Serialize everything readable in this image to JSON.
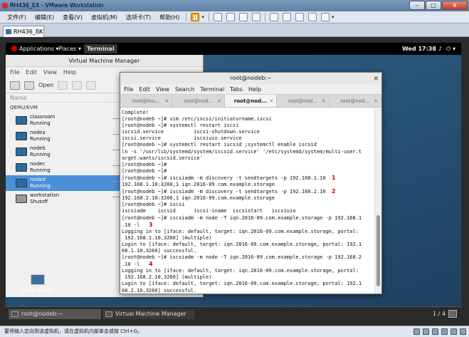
{
  "vmware": {
    "title": "RH436_EX - VMware Workstation",
    "menu": [
      "文件(F)",
      "编辑(E)",
      "查看(V)",
      "虚拟机(M)",
      "选项卡(T)",
      "帮助(H)"
    ],
    "tab_label": "RH436_EX",
    "tab_close": "×",
    "window_buttons": {
      "minimize": "–",
      "maximize": "□",
      "close": "×"
    },
    "status_text": "要将输入定向到该虚拟机，请在虚拟机内部单击或按 Ctrl+G。"
  },
  "gnome": {
    "applications": "Applications ▾",
    "places": "Places ▾",
    "terminal": "Terminal",
    "clock": "Wed 17:38",
    "sys_icons": [
      "♪",
      "⏻ ▾"
    ],
    "desktop_icon_label": "View nodec",
    "taskbar": [
      {
        "label": "root@nodeb:~"
      },
      {
        "label": "Virtual Machine Manager"
      }
    ],
    "pager": "1 / 4"
  },
  "vmm": {
    "title": "Virtual Machine Manager",
    "menu": [
      "File",
      "Edit",
      "View",
      "Help"
    ],
    "toolbar": {
      "open": "Open"
    },
    "header_name": "Name",
    "connection": "QEMU/KVM",
    "vms": [
      {
        "name": "classroom",
        "status": "Running",
        "selected": false,
        "off": false
      },
      {
        "name": "nodea",
        "status": "Running",
        "selected": false,
        "off": false
      },
      {
        "name": "nodeb",
        "status": "Running",
        "selected": false,
        "off": false
      },
      {
        "name": "nodec",
        "status": "Running",
        "selected": false,
        "off": false
      },
      {
        "name": "noded",
        "status": "Running",
        "selected": true,
        "off": false
      },
      {
        "name": "workstation",
        "status": "Shutoff",
        "selected": false,
        "off": true
      }
    ]
  },
  "terminal": {
    "title": "root@nodeb:~",
    "menu": [
      "File",
      "Edit",
      "View",
      "Search",
      "Terminal",
      "Tabs",
      "Help"
    ],
    "tabs": [
      {
        "label": "root@fou...",
        "active": false
      },
      {
        "label": "root@nod...",
        "active": false
      },
      {
        "label": "root@nod...",
        "active": true
      },
      {
        "label": "root@nod...",
        "active": false
      },
      {
        "label": "root@nod...",
        "active": false
      }
    ],
    "lines": [
      {
        "text": "Complete!"
      },
      {
        "text": "[root@nodeb ~]# vim /etc/iscsi/initiatorname.iscsi"
      },
      {
        "text": "[root@nodeb ~]# systemctl restart iscsi"
      },
      {
        "text": "iscsid.service          iscsi-shutdown.service"
      },
      {
        "text": "iscsi.service           iscsiuio.service"
      },
      {
        "text": "[root@nodeb ~]# systemctl restart iscsid ;systemctl enable iscsid"
      },
      {
        "text": "ln -s '/usr/lib/systemd/system/iscsid.service' '/etc/systemd/system/multi-user.t"
      },
      {
        "text": "arget.wants/iscsid.service'"
      },
      {
        "text": "[root@nodeb ~]#"
      },
      {
        "text": "[root@nodeb ~]#"
      },
      {
        "text": "[root@nodeb ~]# iscsiadm -m discovery -t sendtargets -p 192.168.1.10  ",
        "anno": "1"
      },
      {
        "text": "192.168.1.10:3260,1 iqn.2016-09.com.example.storage"
      },
      {
        "text": "[root@nodeb ~]# iscsiadm -m discovery -t sendtargets -p 192.168.2.10  ",
        "anno": "2"
      },
      {
        "text": "192.168.2.10:3260,1 iqn.2016-09.com.example.storage"
      },
      {
        "text": "[root@nodeb ~]# iscsi"
      },
      {
        "text": "iscsiadm    iscsid      iscsi-iname  iscsistart   iscsiuio"
      },
      {
        "text": "[root@nodeb ~]# iscsiadm -m node -T iqn.2016-09.com.example.storage -p 192.168.1"
      },
      {
        "text": ".10 -l   ",
        "anno": "3"
      },
      {
        "text": "Logging in to [iface: default, target: iqn.2016-09.com.example.storage, portal:"
      },
      {
        "text": " 192.168.1.10,3260] (multiple)"
      },
      {
        "text": "Login to [iface: default, target: iqn.2016-09.com.example.storage, portal: 192.1"
      },
      {
        "text": "68.1.10,3260] successful."
      },
      {
        "text": "[root@nodeb ~]# iscsiadm -m node -T iqn.2016-09.com.example.storage -p 192.168.2"
      },
      {
        "text": ".10 -l   ",
        "anno": "4"
      },
      {
        "text": "Logging in to [iface: default, target: iqn.2016-09.com.example.storage, portal:"
      },
      {
        "text": " 192.168.2.10,3260] (multiple)"
      },
      {
        "text": "Login to [iface: default, target: iqn.2016-09.com.example.storage, portal: 192.1"
      },
      {
        "text": "68.2.10,3260] successful."
      },
      {
        "text": "[root@nodeb ~]# ",
        "cursor": true
      }
    ]
  }
}
